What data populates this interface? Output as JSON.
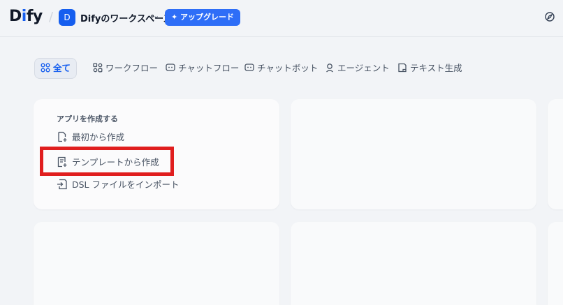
{
  "header": {
    "logo_d": "D",
    "logo_i": "i",
    "logo_fy": "fy",
    "workspace_avatar": "D",
    "workspace_name": "Difyのワークスペース",
    "upgrade_label": "アップグレード"
  },
  "tabs": [
    {
      "label": "全て",
      "icon": "grid-icon",
      "active": true
    },
    {
      "label": "ワークフロー",
      "icon": "workflow-icon"
    },
    {
      "label": "チャットフロー",
      "icon": "chatflow-icon"
    },
    {
      "label": "チャットボット",
      "icon": "chatbot-icon"
    },
    {
      "label": "エージェント",
      "icon": "agent-icon"
    },
    {
      "label": "テキスト生成",
      "icon": "text-gen-icon"
    }
  ],
  "create": {
    "title": "アプリを作成する",
    "items": [
      {
        "label": "最初から作成",
        "icon": "file-plus-icon"
      },
      {
        "label": "テンプレートから作成",
        "icon": "template-icon"
      },
      {
        "label": "DSL ファイルをインポート",
        "icon": "import-icon"
      }
    ]
  },
  "colors": {
    "accent": "#155eef",
    "highlight": "#e01e1e",
    "background": "#f2f4f7"
  }
}
